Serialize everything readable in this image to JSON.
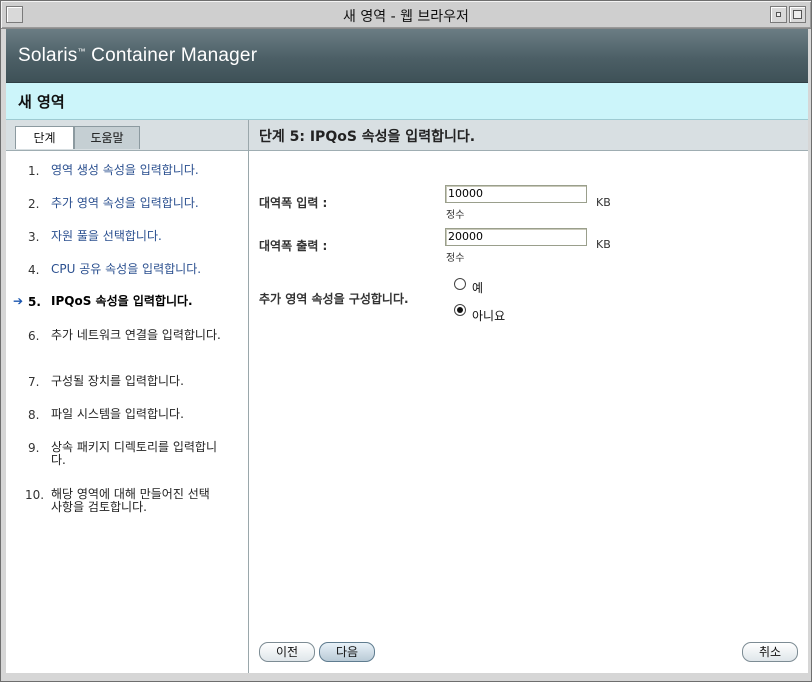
{
  "window": {
    "title": "새 영역 - 웹 브라우저"
  },
  "masthead": {
    "brand": "Solaris",
    "brand_tm": "™",
    "brand_rest": " Container Manager"
  },
  "page": {
    "title": "새 영역"
  },
  "tabs": [
    {
      "label": "단계",
      "active": true
    },
    {
      "label": "도움말",
      "active": false
    }
  ],
  "steps": [
    {
      "num": "1.",
      "label": "영역 생성 속성을 입력합니다."
    },
    {
      "num": "2.",
      "label": "추가 영역 속성을 입력합니다."
    },
    {
      "num": "3.",
      "label": "자원 풀을 선택합니다."
    },
    {
      "num": "4.",
      "label": "CPU 공유 속성을 입력합니다."
    },
    {
      "num": "5.",
      "label": "IPQoS 속성을 입력합니다.",
      "current": true
    },
    {
      "num": "6.",
      "label": "추가 네트워크 연결을 입력합니다."
    },
    {
      "num": "7.",
      "label": "구성될 장치를 입력합니다."
    },
    {
      "num": "8.",
      "label": "파일 시스템을 입력합니다."
    },
    {
      "num": "9.",
      "label": "상속 패키지 디렉토리를 입력합니다."
    },
    {
      "num": "10.",
      "label": "해당 영역에 대해 만들어진 선택 사항을 검토합니다."
    }
  ],
  "current_step_arrow": "➔",
  "step_header": {
    "title": "단계 5:  IPQoS 속성을 입력합니다."
  },
  "form": {
    "bandwidth_in": {
      "label": "대역폭 입력 :",
      "value": "10000",
      "hint": "정수",
      "unit": "KB"
    },
    "bandwidth_out": {
      "label": "대역폭 출력 :",
      "value": "20000",
      "hint": "정수",
      "unit": "KB"
    },
    "additional": {
      "label": "추가 영역 속성을 구성합니다.",
      "options": [
        {
          "label": "예",
          "checked": false
        },
        {
          "label": "아니요",
          "checked": true
        }
      ]
    }
  },
  "buttons": {
    "prev": "이전",
    "next": "다음",
    "cancel": "취소"
  }
}
